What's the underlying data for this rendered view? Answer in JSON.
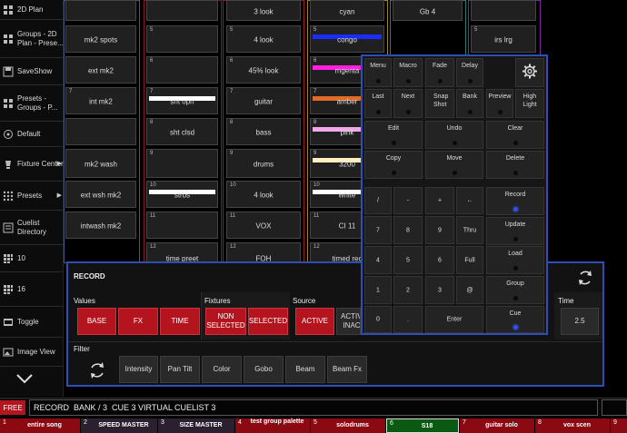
{
  "sidebar": {
    "items": [
      {
        "label": "2D Plan",
        "icon": "grid-icon"
      },
      {
        "label": "Groups - 2D Plan - Prese...",
        "icon": "grid-icon"
      },
      {
        "label": "SaveShow",
        "icon": "save-icon"
      },
      {
        "label": "Presets - Groups - P...",
        "icon": "grid-icon"
      },
      {
        "label": "Default",
        "icon": "default-icon"
      },
      {
        "label": "Fixture Center",
        "icon": "fixture-icon"
      },
      {
        "label": "Presets",
        "icon": "presets-icon"
      },
      {
        "label": "Cuelist Directory",
        "icon": "cuelist-icon"
      },
      {
        "label": "10",
        "icon": "grid-icon"
      },
      {
        "label": "16",
        "icon": "grid-icon"
      },
      {
        "label": "Toggle",
        "icon": "toggle-icon"
      },
      {
        "label": "Image View",
        "icon": "image-icon"
      }
    ],
    "scroll_down": "chevron-down-icon"
  },
  "columns": {
    "col1": [
      {
        "num": "",
        "label": ""
      },
      {
        "num": "",
        "label": "mk2 spots"
      },
      {
        "num": "",
        "label": "ext mk2"
      },
      {
        "num": "7",
        "label": "int mk2"
      },
      {
        "num": "",
        "label": ""
      },
      {
        "num": "",
        "label": "mk2 wash"
      },
      {
        "num": "",
        "label": "ext wsh mk2"
      },
      {
        "num": "",
        "label": "intwash mk2"
      }
    ],
    "col2": [
      {
        "num": "",
        "label": ""
      },
      {
        "num": "5",
        "label": ""
      },
      {
        "num": "6",
        "label": ""
      },
      {
        "num": "7",
        "label": "sht opn"
      },
      {
        "num": "8",
        "label": "sht clsd"
      },
      {
        "num": "9",
        "label": ""
      },
      {
        "num": "10",
        "label": "strbs"
      },
      {
        "num": "11",
        "label": ""
      },
      {
        "num": "12",
        "label": "time preet"
      }
    ],
    "col3": [
      {
        "num": "",
        "label": "3 look"
      },
      {
        "num": "5",
        "label": "4 look"
      },
      {
        "num": "6",
        "label": "45% look"
      },
      {
        "num": "7",
        "label": "guitar"
      },
      {
        "num": "8",
        "label": "bass"
      },
      {
        "num": "9",
        "label": "drums"
      },
      {
        "num": "10",
        "label": "4 look"
      },
      {
        "num": "11",
        "label": "VOX"
      },
      {
        "num": "12",
        "label": "FOH"
      }
    ],
    "col4": [
      {
        "num": "",
        "label": "cyan",
        "color": ""
      },
      {
        "num": "5",
        "label": "congo",
        "color": "#1a2cff"
      },
      {
        "num": "6",
        "label": "mgenta",
        "color": "#ff20e0"
      },
      {
        "num": "7",
        "label": "amber",
        "color": "#e06a2a"
      },
      {
        "num": "8",
        "label": "pink",
        "color": "#f0a8e8"
      },
      {
        "num": "9",
        "label": "3200",
        "color": "#fff0c0"
      },
      {
        "num": "10",
        "label": "white",
        "color": "#ffffff"
      },
      {
        "num": "11",
        "label": "CI 11",
        "color": ""
      },
      {
        "num": "12",
        "label": "timed rec",
        "color": ""
      }
    ],
    "col5": [
      {
        "num": "",
        "label": "Gb 4"
      }
    ],
    "col6": [
      {
        "num": "",
        "label": ""
      },
      {
        "num": "5",
        "label": "irs lrg"
      }
    ]
  },
  "record": {
    "title": "RECORD",
    "values_label": "Values",
    "values_buttons": [
      "BASE",
      "FX",
      "TIME"
    ],
    "fixtures_label": "Fixtures",
    "fixtures_buttons": [
      "NON SELECTED",
      "SELECTED"
    ],
    "source_label": "Source",
    "source_buttons": [
      "ACTIVE",
      "ACTIVE INACT"
    ],
    "time_label": "Time",
    "time_value": "2.5",
    "filter_label": "Filter",
    "filter_buttons": [
      "Intensity",
      "Pan Tilt",
      "Color",
      "Gobo",
      "Beam",
      "Beam Fx"
    ]
  },
  "keypad": {
    "row1": [
      "Menu",
      "Macro",
      "Fade",
      "Delay"
    ],
    "row2": [
      "Last",
      "Next",
      "Snap Shot",
      "Bank",
      "Preview",
      "High Light"
    ],
    "row3": [
      "Edit",
      "Undo",
      "Clear"
    ],
    "row4": [
      "Copy",
      "Move",
      "Delete"
    ],
    "ops": [
      "/",
      "-",
      "+",
      "←"
    ],
    "digits_r1": [
      "7",
      "8",
      "9",
      "Thru"
    ],
    "digits_r2": [
      "4",
      "5",
      "6",
      "Full"
    ],
    "digits_r3": [
      "1",
      "2",
      "3",
      "@"
    ],
    "digits_r4": [
      "0",
      ".",
      "Enter"
    ],
    "right_buttons": [
      "Record",
      "Update",
      "Load",
      "Group",
      "Cue"
    ]
  },
  "command_line": {
    "free_label": "FREE",
    "text": "RECORD  BANK / 3  CUE 3 VIRTUAL CUELIST 3"
  },
  "playbacks": [
    {
      "num": "1",
      "label": "entire song",
      "color": "#8b0a12"
    },
    {
      "num": "2",
      "label": "SPEED MASTER",
      "color": "#2a2030"
    },
    {
      "num": "3",
      "label": "SIZE MASTER",
      "color": "#2a2030"
    },
    {
      "num": "4",
      "label": "test group palette",
      "color": "#8b0a12"
    },
    {
      "num": "5",
      "label": "solodrums",
      "color": "#8b0a12"
    },
    {
      "num": "6",
      "label": "S18",
      "color": "#0a5a14"
    },
    {
      "num": "7",
      "label": "guitar solo",
      "color": "#8b0a12"
    },
    {
      "num": "8",
      "label": "vox scen",
      "color": "#8b0a12"
    },
    {
      "num": "9",
      "label": "",
      "color": "#8b0a12"
    }
  ],
  "colors": {
    "accent_blue": "#2d4eb4",
    "record_red": "#b3141e"
  }
}
